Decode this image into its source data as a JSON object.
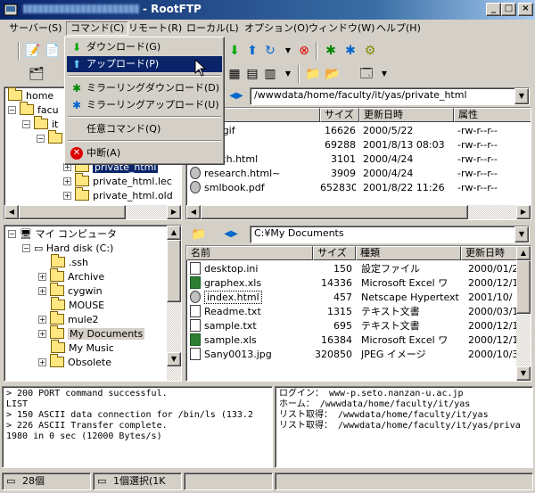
{
  "window": {
    "title": "- RootFTP",
    "minimize": "_",
    "maximize": "□",
    "close": "×"
  },
  "menus": [
    "サーバー(S)",
    "コマンド(C)",
    "リモート(R)",
    "ローカル(L)",
    "オプション(O)",
    "ウィンドウ(W)",
    "ヘルプ(H)"
  ],
  "dropdown": {
    "items": [
      {
        "label": "ダウンロード(G)",
        "icon": "arrow-down-icon"
      },
      {
        "label": "アップロード(P)",
        "icon": "arrow-up-icon"
      },
      {
        "label": "ミラーリングダウンロード(D)",
        "icon": "mirror-download-icon"
      },
      {
        "label": "ミラーリングアップロード(U)",
        "icon": "mirror-upload-icon"
      },
      {
        "label": "任意コマンド(Q)",
        "icon": ""
      },
      {
        "label": "中断(A)",
        "icon": "stop-icon"
      }
    ]
  },
  "remote_tree": {
    "items": [
      {
        "label": "home"
      },
      {
        "label": "facu"
      },
      {
        "label": "it"
      },
      {
        "label": "y"
      },
      {
        "label": "private_html"
      },
      {
        "label": "private_html.lec"
      },
      {
        "label": "private_html.old"
      }
    ]
  },
  "remote_path": "/wwwdata/home/faculty/it/yas/private_html",
  "remote_files": {
    "headers": [
      "名前",
      "サイズ",
      "更新日時",
      "属性"
    ],
    "rows": [
      [
        "anzan.gif",
        "16626",
        "2000/5/22",
        "-rw-r--r--"
      ],
      [
        "cc.pdf",
        "69288",
        "2001/8/13 08:03",
        "-rw-r--r--"
      ],
      [
        "research.html",
        "3101",
        "2000/4/24",
        "-rw-r--r--"
      ],
      [
        "research.html~",
        "3909",
        "2000/4/24",
        "-rw-r--r--"
      ],
      [
        "smlbook.pdf",
        "652830",
        "2001/8/22 11:26",
        "-rw-r--r--"
      ]
    ]
  },
  "local_tree": {
    "items": [
      {
        "label": "マイ コンピュータ"
      },
      {
        "label": "Hard disk (C:)"
      },
      {
        "label": ".ssh"
      },
      {
        "label": "Archive"
      },
      {
        "label": "cygwin"
      },
      {
        "label": "MOUSE"
      },
      {
        "label": "mule2"
      },
      {
        "label": "My Documents"
      },
      {
        "label": "My Music"
      },
      {
        "label": "Obsolete"
      }
    ]
  },
  "local_path": "C:¥My Documents",
  "local_files": {
    "headers": [
      "名前",
      "サイズ",
      "種類",
      "更新日時"
    ],
    "rows": [
      [
        "desktop.ini",
        "150",
        "設定ファイル",
        "2000/01/2"
      ],
      [
        "graphex.xls",
        "14336",
        "Microsoft Excel ワ",
        "2000/12/1"
      ],
      [
        "index.html",
        "457",
        "Netscape Hypertext...",
        "2001/10/"
      ],
      [
        "Readme.txt",
        "1315",
        "テキスト文書",
        "2000/03/1"
      ],
      [
        "sample.txt",
        "695",
        "テキスト文書",
        "2000/12/1"
      ],
      [
        "sample.xls",
        "16384",
        "Microsoft Excel ワ",
        "2000/12/1"
      ],
      [
        "Sany0013.jpg",
        "320850",
        "JPEG イメージ",
        "2000/10/3"
      ]
    ]
  },
  "log_left": "> 200 PORT command successful.\nLIST\n> 150 ASCII data connection for /bin/ls (133.2\n> 226 ASCII Transfer complete.\n1980 in 0 sec (12000 Bytes/s)",
  "log_right": "ログイン： www-p.seto.nanzan-u.ac.jp\nホーム： /wwwdata/home/faculty/it/yas\nリスト取得： /wwwdata/home/faculty/it/yas\nリスト取得： /wwwdata/home/faculty/it/yas/priva",
  "status": {
    "left": "28個",
    "mid": "1個選択(1K"
  }
}
